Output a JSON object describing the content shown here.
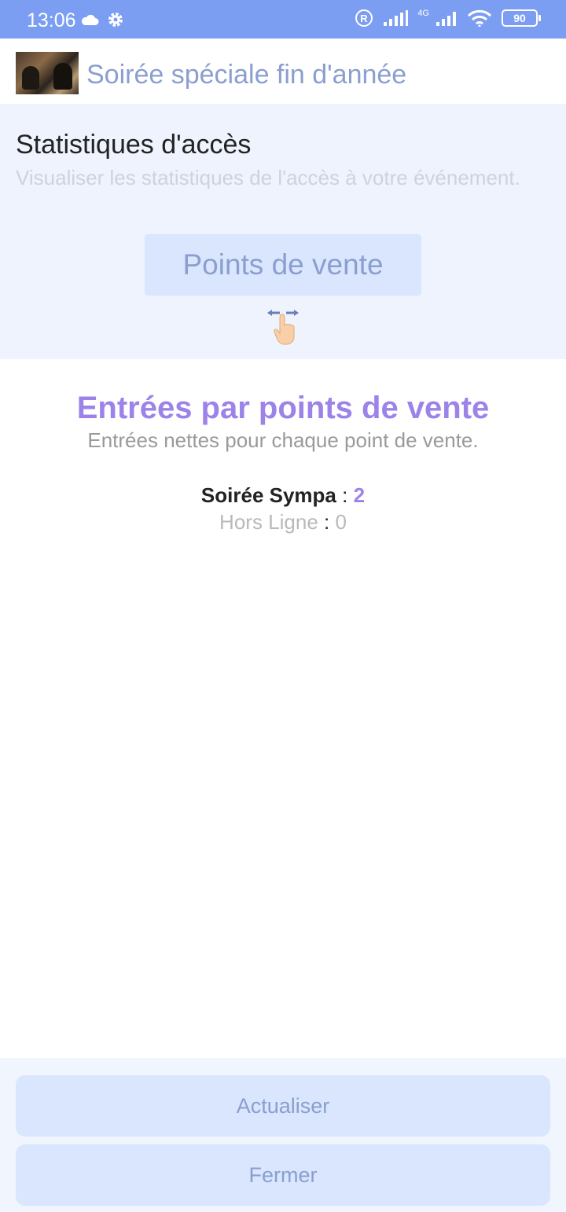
{
  "status_bar": {
    "time": "13:06",
    "network_label": "4G",
    "battery": "90",
    "icons": [
      "cloud-icon",
      "settings-gear-icon",
      "registered-icon",
      "signal-icon",
      "signal-4g-icon",
      "wifi-icon",
      "battery-icon"
    ]
  },
  "header": {
    "title": "Soirée spéciale fin d'année",
    "thumbnail": "event-thumbnail"
  },
  "stats": {
    "title": "Statistiques d'accès",
    "description": "Visualiser les statistiques de l'accès à votre événement.",
    "points_button": "Points de vente",
    "swipe_icon": "swipe-hand-icon"
  },
  "main": {
    "title": "Entrées par points de vente",
    "subtitle": "Entrées nettes pour chaque point de vente.",
    "separator": ":",
    "rows": [
      {
        "name": "Soirée Sympa",
        "value": "2"
      },
      {
        "name": "Hors Ligne",
        "value": "0"
      }
    ]
  },
  "footer": {
    "refresh_label": "Actualiser",
    "close_label": "Fermer"
  },
  "colors": {
    "status_bar": "#7b9ef2",
    "accent": "#9d83e9",
    "button_bg": "#d9e6fd",
    "button_text": "#8a9fd0",
    "section_bg": "#eef3fd"
  }
}
